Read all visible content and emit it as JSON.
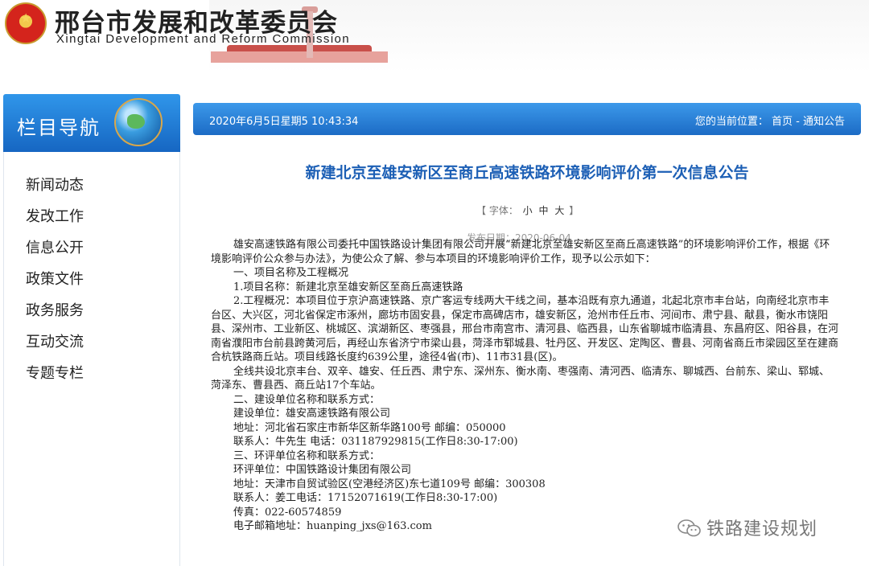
{
  "header": {
    "title": "邢台市发展和改革委员会",
    "subtitle": "Xingtai Development and Reform Commission"
  },
  "sidebar": {
    "heading": "栏目导航",
    "items": [
      {
        "label": "新闻动态"
      },
      {
        "label": "发改工作"
      },
      {
        "label": "信息公开"
      },
      {
        "label": "政策文件"
      },
      {
        "label": "政务服务"
      },
      {
        "label": "互动交流"
      },
      {
        "label": "专题专栏"
      }
    ]
  },
  "topbar": {
    "datetime": "2020年6月5日星期5 10:43:34",
    "location_label": "您的当前位置：",
    "breadcrumb": "首页 - 通知公告"
  },
  "article": {
    "title": "新建北京至雄安新区至商丘高速铁路环境影响评价第一次信息公告",
    "font_label_open": "【 字体：",
    "font_small": "小",
    "font_medium": "中",
    "font_large": "大",
    "font_label_close": "】",
    "pubdate": "发布日期：2020-06-04",
    "paragraphs": [
      {
        "text": "雄安高速铁路有限公司委托中国铁路设计集团有限公司开展“新建北京至雄安新区至商丘高速铁路”的环境影响评价工作，根据《环境影响评价公众参与办法》，为使公众了解、参与本项目的环境影响评价工作，现予以公示如下：",
        "style": "indent"
      },
      {
        "text": "一、项目名称及工程概况",
        "style": "pad"
      },
      {
        "text": "1.项目名称：新建北京至雄安新区至商丘高速铁路",
        "style": "pad"
      },
      {
        "text": "2.工程概况：本项目位于京沪高速铁路、京广客运专线两大干线之间，基本沿既有京九通道，北起北京市丰台站，向南经北京市丰台区、大兴区，河北省保定市涿州，廊坊市固安县，保定市高碑店市，雄安新区，沧州市任丘市、河间市、肃宁县、献县，衡水市饶阳县、深州市、工业新区、桃城区、滨湖新区、枣强县，邢台市南宫市、清河县、临西县，山东省聊城市临清县、东昌府区、阳谷县，在河南省濮阳市台前县跨黄河后，再经山东省济宁市梁山县，菏泽市郓城县、牡丹区、开发区、定陶区、曹县、河南省商丘市梁园区至在建商合杭铁路商丘站。项目线路长度约639公里，途径4省(市)、11市31县(区)。",
        "style": "indent"
      },
      {
        "text": "全线共设北京丰台、双辛、雄安、任丘西、肃宁东、深州东、衡水南、枣强南、清河西、临清东、聊城西、台前东、梁山、郓城、菏泽东、曹县西、商丘站17个车站。",
        "style": "indent"
      },
      {
        "text": "二、建设单位名称和联系方式：",
        "style": "pad"
      },
      {
        "text": "建设单位：雄安高速铁路有限公司",
        "style": "pad"
      },
      {
        "text": "地址：河北省石家庄市新华区新华路100号 邮编：050000",
        "style": "pad"
      },
      {
        "text": "联系人：牛先生 电话：031187929815(工作日8:30-17:00)",
        "style": "pad"
      },
      {
        "text": "三、环评单位名称和联系方式：",
        "style": "pad"
      },
      {
        "text": "环评单位：中国铁路设计集团有限公司",
        "style": "pad"
      },
      {
        "text": "地址：天津市自贸试验区(空港经济区)东七道109号 邮编：300308",
        "style": "pad"
      },
      {
        "text": "联系人：姜工电话：17152071619(工作日8:30-17:00)",
        "style": "pad"
      },
      {
        "text": "传真：022-60574859",
        "style": "pad"
      },
      {
        "text": "电子邮箱地址：huanping_jxs@163.com",
        "style": "pad"
      }
    ]
  },
  "watermark": {
    "text": "铁路建设规划",
    "icon": "wechat-icon"
  },
  "colors": {
    "accent_blue": "#1e7fd8",
    "title_blue": "#1c5fb5"
  }
}
